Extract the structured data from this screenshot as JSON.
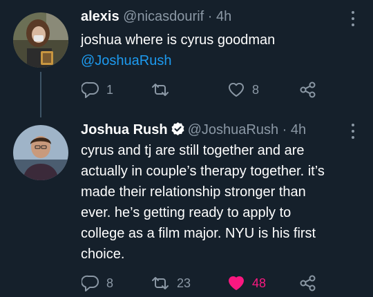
{
  "tweets": [
    {
      "name": "alexis",
      "handle": "@nicasdourif",
      "separator": "·",
      "time": "4h",
      "text": "joshua where is cyrus goodman",
      "mention": "@JoshuaRush",
      "replies": "1",
      "retweets": "",
      "likes": "8",
      "liked": false,
      "verified": false
    },
    {
      "name": "Joshua Rush",
      "handle": "@JoshuaRush",
      "separator": "·",
      "time": "4h",
      "verified": true,
      "text_lines": [
        "cyrus and tj are still together and are",
        "actually in couple’s therapy together. it’s",
        "made their relationship stronger than",
        "ever. he’s getting ready to apply to",
        "college as a film major. NYU is his first",
        "choice."
      ],
      "replies": "8",
      "retweets": "23",
      "likes": "48",
      "liked": true
    }
  ],
  "colors": {
    "background": "#15202b",
    "text": "#ffffff",
    "secondary": "#8b98a5",
    "link": "#1d9bf0",
    "like_active": "#f91880",
    "verified": "#ffffff"
  },
  "icons": {
    "reply": "reply-icon",
    "retweet": "retweet-icon",
    "like": "heart-icon",
    "share": "share-icon",
    "more": "more-icon",
    "verified": "verified-badge-icon"
  }
}
